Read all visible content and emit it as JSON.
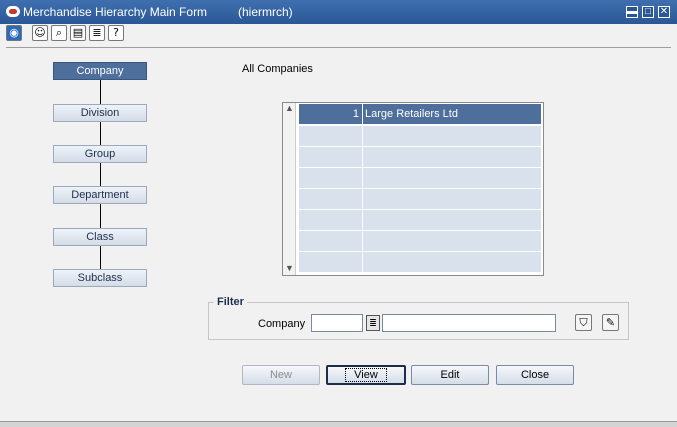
{
  "window": {
    "title": "Merchandise Hierarchy Main Form",
    "form_id": "(hiermrch)",
    "controls": {
      "minimize": "▬",
      "maximize": "□",
      "close": "✕"
    }
  },
  "toolbar": {
    "icons": [
      "globe-icon",
      "help-icon",
      "find-icon",
      "clipboard-icon",
      "notes-icon",
      "question-icon"
    ]
  },
  "hierarchy": {
    "levels": [
      "Company",
      "Division",
      "Group",
      "Department",
      "Class",
      "Subclass"
    ],
    "active": "Company"
  },
  "main": {
    "heading": "All Companies",
    "table": {
      "rows": [
        {
          "num": "1",
          "name": "Large Retailers Ltd"
        },
        {
          "num": "",
          "name": ""
        },
        {
          "num": "",
          "name": ""
        },
        {
          "num": "",
          "name": ""
        },
        {
          "num": "",
          "name": ""
        },
        {
          "num": "",
          "name": ""
        },
        {
          "num": "",
          "name": ""
        },
        {
          "num": "",
          "name": ""
        }
      ]
    }
  },
  "filter": {
    "legend": "Filter",
    "company_label": "Company",
    "company_value": "",
    "company_desc": ""
  },
  "buttons": {
    "new": "New",
    "view": "View",
    "edit": "Edit",
    "close": "Close"
  },
  "colors": {
    "titlebar": "#2a5897",
    "selected": "#4e6e9c",
    "row": "#d8e1ec"
  }
}
